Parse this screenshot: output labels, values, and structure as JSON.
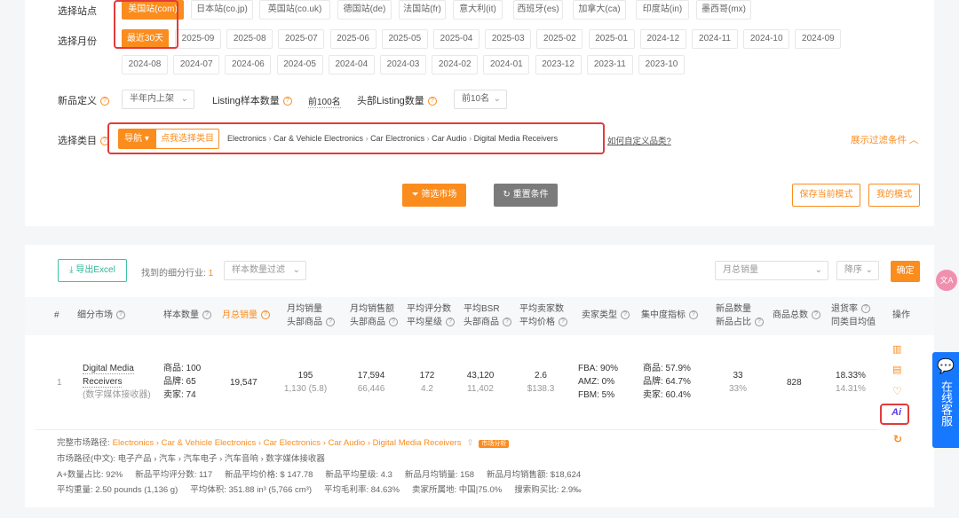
{
  "filters": {
    "site_label": "选择站点",
    "sites": [
      "美国站(com)",
      "日本站(co.jp)",
      "英国站(co.uk)",
      "德国站(de)",
      "法国站(fr)",
      "意大利(it)",
      "西班牙(es)",
      "加拿大(ca)",
      "印度站(in)",
      "墨西哥(mx)"
    ],
    "month_label": "选择月份",
    "months_row1": [
      "最近30天",
      "2025-09",
      "2025-08",
      "2025-07",
      "2025-06",
      "2025-05",
      "2025-04",
      "2025-03",
      "2025-02",
      "2025-01",
      "2024-12",
      "2024-11",
      "2024-10",
      "2024-09"
    ],
    "months_row2": [
      "2024-08",
      "2024-07",
      "2024-06",
      "2024-05",
      "2024-04",
      "2024-03",
      "2024-02",
      "2024-01",
      "2023-12",
      "2023-11",
      "2023-10"
    ],
    "new_def_label": "新品定义",
    "new_def_value": "半年内上架",
    "listing_sample_label": "Listing样本数量",
    "listing_sample_value": "前100名",
    "head_listing_label": "头部Listing数量",
    "head_listing_value": "前10名",
    "category_label": "选择类目",
    "nav_button": "导航",
    "pick_category": "点我选择类目",
    "category_path": [
      "Electronics",
      "Car & Vehicle Electronics",
      "Car Electronics",
      "Car Audio",
      "Digital Media Receivers"
    ],
    "custom_category_link": "如何自定义品类?",
    "show_filters": "展示过滤条件",
    "filter_button": "筛选市场",
    "reset_button": "重置条件",
    "save_mode": "保存当前模式",
    "my_mode": "我的模式"
  },
  "toolbar": {
    "export": "导出Excel",
    "found_label": "找到的细分行业:",
    "found_count": "1",
    "sample_filter_placeholder": "样本数量过滤",
    "sort_field": "月总销量",
    "sort_order": "降序",
    "confirm": "确定"
  },
  "table": {
    "headers": {
      "index": "#",
      "market": "细分市场",
      "samples": "样本数量",
      "total_sales": "月总销量",
      "avg_sales": [
        "月均销量",
        "头部商品"
      ],
      "avg_revenue": [
        "月均销售额",
        "头部商品"
      ],
      "avg_reviews": [
        "平均评分数",
        "平均星级"
      ],
      "avg_bsr": [
        "平均BSR",
        "头部商品"
      ],
      "avg_sellers": [
        "平均卖家数",
        "平均价格"
      ],
      "seller_type": "卖家类型",
      "concentration": "集中度指标",
      "new_products": [
        "新品数量",
        "新品占比"
      ],
      "total_products": "商品总数",
      "return_rate": [
        "退货率",
        "同类目均值"
      ],
      "actions": "操作"
    },
    "rows": [
      {
        "index": "1",
        "market_en": "Digital Media Receivers",
        "market_cn": "(数字媒体接收器)",
        "samples": [
          "商品: 100",
          "品牌: 65",
          "卖家: 74"
        ],
        "total_sales": "19,547",
        "avg_sales": "195",
        "avg_sales_head": "1,130 (5.8)",
        "avg_revenue": "17,594",
        "avg_revenue_head": "66,446",
        "avg_reviews": "172",
        "avg_rating": "4.2",
        "avg_bsr": "43,120",
        "avg_bsr_head": "11,402",
        "avg_sellers": "2.6",
        "avg_price": "$138.3",
        "seller_type": [
          "FBA: 90%",
          "AMZ: 0%",
          "FBM: 5%"
        ],
        "concentration": [
          "商品: 57.9%",
          "品牌: 64.7%",
          "卖家: 60.4%"
        ],
        "new_count": "33",
        "new_ratio": "33%",
        "total_products": "828",
        "return_rate": "18.33%",
        "return_avg": "14.31%",
        "action_ai": "Ai"
      }
    ]
  },
  "details": {
    "full_path_label": "完整市场路径:",
    "full_path": "Electronics › Car & Vehicle Electronics › Car Electronics › Car Audio › Digital Media Receivers",
    "market_analysis_badge": "市场分析",
    "cn_path": "市场路径(中文): 电子产品 › 汽车 › 汽车电子 › 汽车音响 › 数字媒体接收器",
    "line3": [
      "A+数量占比: 92%",
      "新品平均评分数: 117",
      "新品平均价格: $ 147.78",
      "新品平均星级: 4.3",
      "新品月均销量: 158",
      "新品月均销售额: $18,624"
    ],
    "line4": [
      "平均重量: 2.50 pounds (1,136 g)",
      "平均体积: 351.88 in³ (5,766 cm³)",
      "平均毛利率: 84.63%",
      "卖家所属地: 中国|75.0%",
      "搜索购买比: 2.9‰"
    ]
  },
  "support": {
    "label": "在线客服"
  },
  "colors": {
    "accent": "#fb8c1e",
    "highlight": "#e23b3b",
    "support": "#1677ff"
  }
}
